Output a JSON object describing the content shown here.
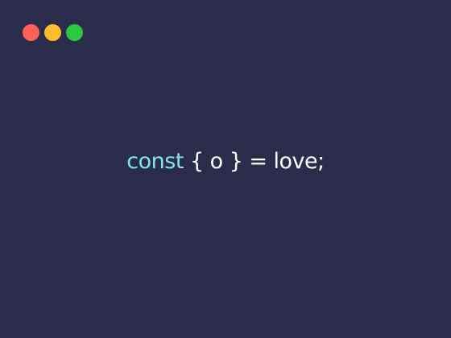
{
  "window": {
    "controls": [
      {
        "name": "close",
        "color": "#fe5f57"
      },
      {
        "name": "minimize",
        "color": "#febc2e"
      },
      {
        "name": "maximize",
        "color": "#28c840"
      }
    ]
  },
  "code": {
    "keyword": "const",
    "open_brace": "{",
    "identifier": "o",
    "close_brace": "}",
    "operator": "=",
    "value": "love;",
    "colors": {
      "keyword": "#7ee6ea",
      "punctuation": "#ffffff",
      "identifier": "#ffffff",
      "value": "#ffffff",
      "background": "#2b2c49"
    }
  }
}
